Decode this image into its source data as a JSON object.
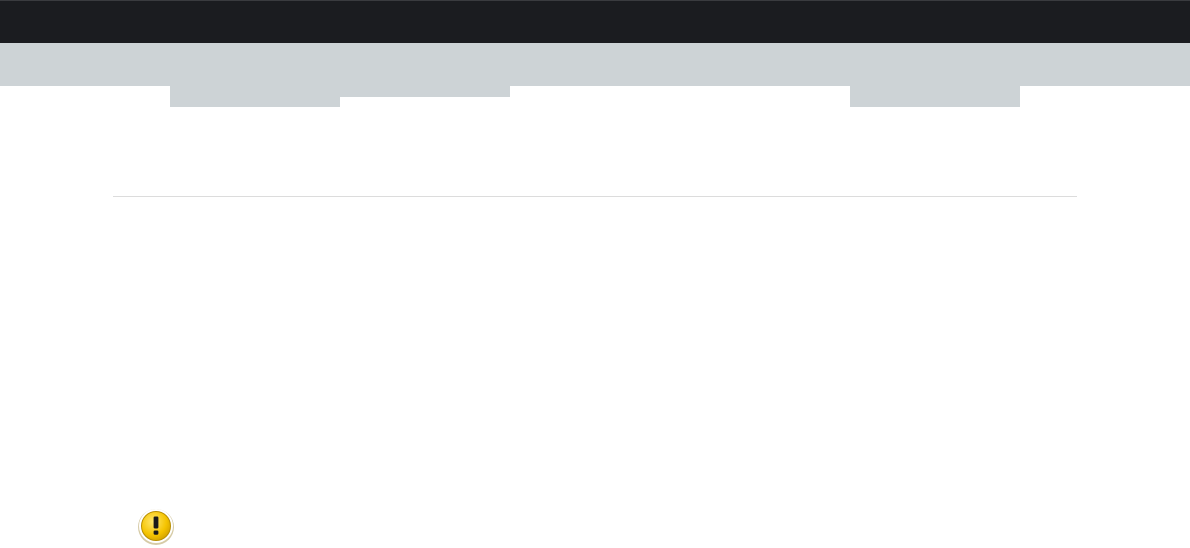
{
  "header": {
    "background_color": "#1b1c20"
  },
  "nav": {
    "background_color": "#cdd3d6",
    "tabs": [
      {
        "id": "tab-1",
        "label": ""
      },
      {
        "id": "tab-2",
        "label": ""
      },
      {
        "id": "tab-3",
        "label": ""
      }
    ]
  },
  "notice": {
    "icon": "warning-icon",
    "icon_color": "#f5c400"
  }
}
